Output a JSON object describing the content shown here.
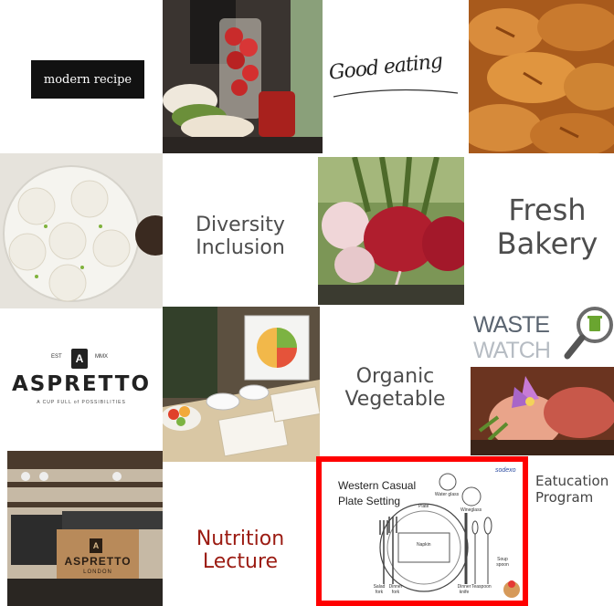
{
  "logos": {
    "modern_recipe": "modern recipe",
    "good_eating": "Good eating",
    "aspretto": "ASPRETTO",
    "aspretto_tagline": "A CUP FULL of POSSIBILITIES",
    "aspretto_badge": "A",
    "aspretto_est": "EST",
    "aspretto_year": "MMX",
    "aspretto_london": "LONDON",
    "waste_top": "WASTE",
    "waste_bottom": "WATCH"
  },
  "labels": {
    "diversity_line1": "Diversity",
    "diversity_line2": "Inclusion",
    "fresh_line1": "Fresh",
    "fresh_line2": "Bakery",
    "organic_line1": "Organic",
    "organic_line2": "Vegetable",
    "nutrition_line1": "Nutrition",
    "nutrition_line2": "Lecture",
    "education_line1": "Eatucation",
    "education_line2": "Program"
  },
  "plate_setting": {
    "title_line1": "Western Casual",
    "title_line2": "Plate Setting",
    "brand": "sodexo",
    "plate": "Plate",
    "napkin": "Napkin",
    "water_glass": "Water glass",
    "wine_glass": "Wineglass",
    "salad_fork": "Salad fork",
    "dinner_fork": "Dinner fork",
    "dinner_knife": "Dinner knife",
    "teaspoon": "Teaspoon",
    "soup_spoon": "Soup spoon"
  },
  "colors": {
    "highlight_border": "#ff0000",
    "nutrition_text": "#9b1b12",
    "label_text": "#4d4d4d"
  }
}
